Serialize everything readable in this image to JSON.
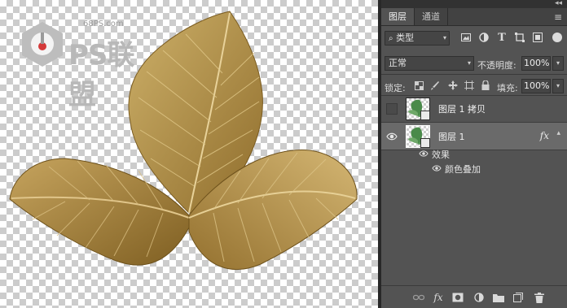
{
  "watermark": {
    "site": "68PS.com",
    "brand": "PS联盟"
  },
  "panel": {
    "tabs": [
      {
        "label": "图层",
        "active": true
      },
      {
        "label": "通道",
        "active": false
      }
    ],
    "filter": {
      "kind_label": "类型",
      "icons": [
        "image-filter-icon",
        "adjustment-filter-icon",
        "type-filter-icon",
        "shape-filter-icon",
        "smartobject-filter-icon"
      ]
    },
    "blend": {
      "mode": "正常",
      "opacity_label": "不透明度:",
      "opacity_value": "100%"
    },
    "lock": {
      "label": "锁定:",
      "fill_label": "填充:",
      "fill_value": "100%"
    },
    "layers": [
      {
        "name": "图层 1 拷贝",
        "visible": false,
        "selected": false,
        "has_fx": false
      },
      {
        "name": "图层 1",
        "visible": true,
        "selected": true,
        "has_fx": true,
        "fx_label": "fx"
      }
    ],
    "effects": {
      "header": "效果",
      "items": [
        "颜色叠加"
      ]
    },
    "bottom_icons": [
      "link-layers-icon",
      "fx-icon",
      "add-mask-icon",
      "adjustment-layer-icon",
      "group-folder-icon",
      "new-layer-icon",
      "trash-icon"
    ]
  },
  "colors": {
    "leaf_light": "#c9a85a",
    "leaf_dark": "#8a6a2a",
    "panel_bg": "#535353",
    "selected_bg": "#6a6a6a"
  }
}
